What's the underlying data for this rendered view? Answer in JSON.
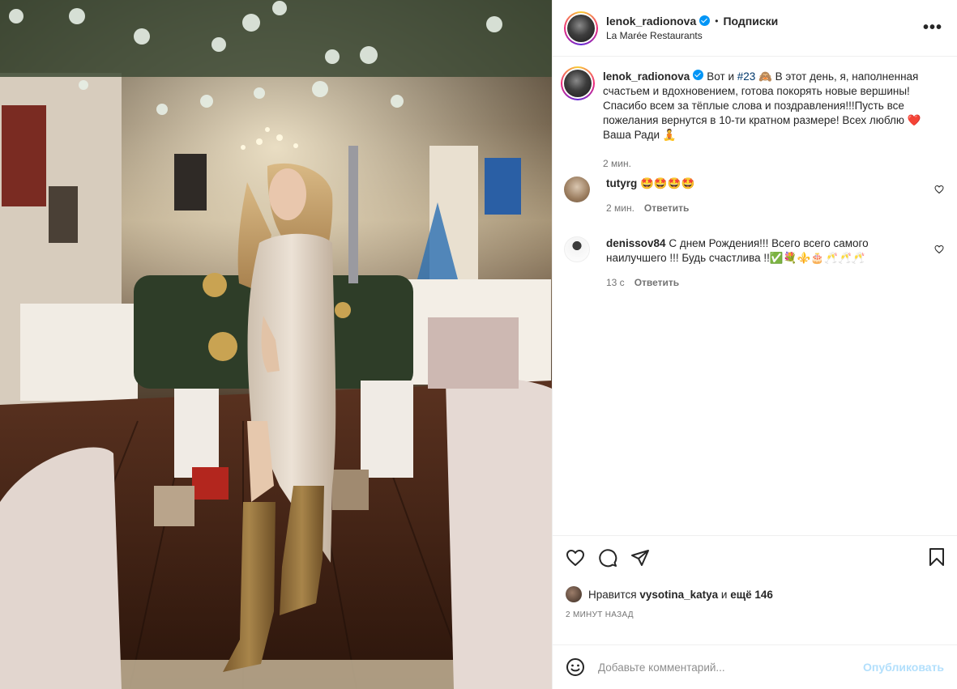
{
  "header": {
    "username": "lenok_radionova",
    "dot": "•",
    "follow_label": "Подписки",
    "location": "La Marée Restaurants",
    "more_label": "•••"
  },
  "caption": {
    "username": "lenok_radionova",
    "text_before": "Вот и ",
    "hashtag": "#23",
    "text_after": " 🙈 В этот день, я, наполненная счастьем и вдохновением, готова покорять новые вершины! Спасибо всем за тёплые слова и поздравления!!!Пусть все пожелания вернутся в 10-ти кратном размере! Всех люблю ❤️ Ваша Ради 🧘",
    "time": "2 мин."
  },
  "comments": [
    {
      "username": "tutyrg",
      "text": "🤩🤩🤩🤩",
      "time": "2 мин.",
      "reply_label": "Ответить"
    },
    {
      "username": "denissov84",
      "text": "С днем Рождения!!! Всего всего самого наилучшего !!! Будь счастлива !!✅💐⚜️🎂🥂🥂🥂",
      "time": "13 с",
      "reply_label": "Ответить"
    }
  ],
  "likes": {
    "prefix": "Нравится",
    "user": "vysotina_katya",
    "and": "и",
    "more": "ещё 146"
  },
  "timestamp": "2 МИНУТ НАЗАД",
  "add_comment": {
    "placeholder": "Добавьте комментарий...",
    "publish_label": "Опубликовать"
  },
  "icons": {
    "like": "heart-icon",
    "comment": "comment-icon",
    "share": "share-icon",
    "save": "bookmark-icon",
    "emoji": "smile-icon",
    "more": "more-icon"
  },
  "colors": {
    "verified": "#0095f6",
    "hashtag": "#00376b",
    "muted": "#737373",
    "publish_disabled": "#b2dffc"
  }
}
